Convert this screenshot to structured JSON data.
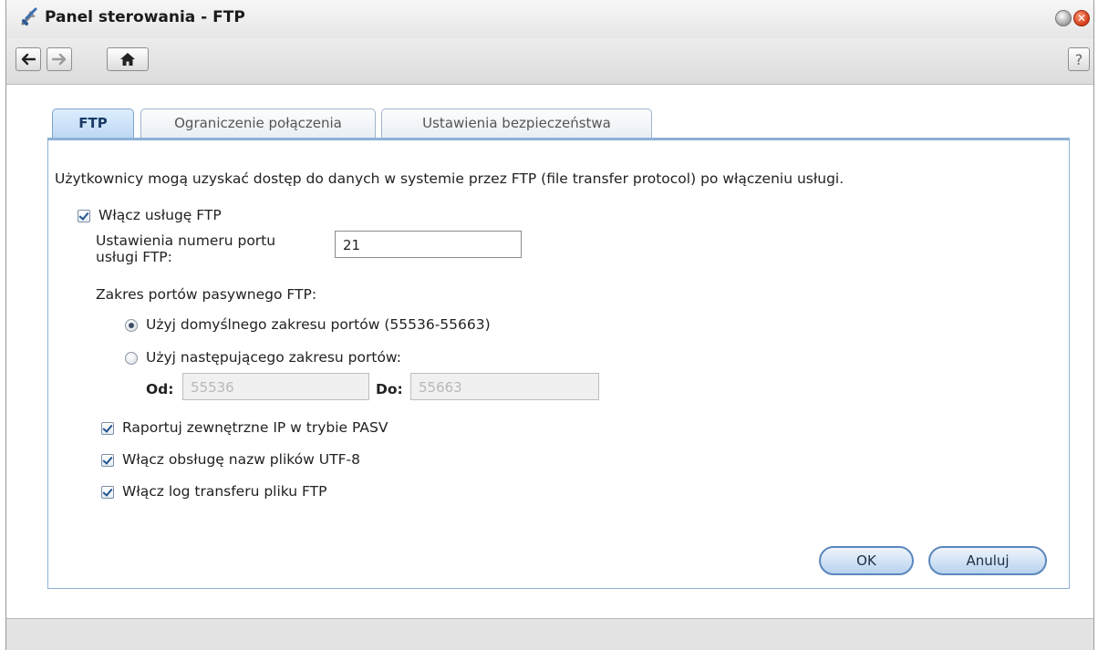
{
  "window": {
    "title": "Panel sterowania - FTP",
    "close_glyph": "✕"
  },
  "toolbar": {
    "back_icon": "arrow-left-icon",
    "forward_icon": "arrow-right-icon",
    "home_icon": "home-icon",
    "help_label": "?"
  },
  "tabs": [
    {
      "label": "FTP",
      "active": true
    },
    {
      "label": "Ograniczenie połączenia",
      "active": false
    },
    {
      "label": "Ustawienia bezpieczeństwa",
      "active": false
    }
  ],
  "description": "Użytkownicy mogą uzyskać dostęp do danych w systemie przez FTP (file transfer protocol) po włączeniu usługi.",
  "enable_ftp": {
    "label": "Włącz usługę FTP",
    "checked": true
  },
  "port": {
    "label_line1": "Ustawienia numeru portu",
    "label_line2": "usługi FTP:",
    "value": "21"
  },
  "passive": {
    "heading": "Zakres portów pasywnego FTP:",
    "option_default": "Użyj domyślnego zakresu portów (55536-55663)",
    "option_custom": "Użyj następującego zakresu portów:",
    "from_label": "Od:",
    "from_placeholder": "55536",
    "to_label": "Do:",
    "to_placeholder": "55663",
    "selected": "default"
  },
  "options": [
    {
      "label": "Raportuj zewnętrzne IP w trybie PASV",
      "checked": true
    },
    {
      "label": "Włącz obsługę nazw plików UTF-8",
      "checked": true
    },
    {
      "label": "Włącz log transferu pliku FTP",
      "checked": true
    }
  ],
  "buttons": {
    "ok": "OK",
    "cancel": "Anuluj"
  },
  "colors": {
    "accent": "#5a87bd",
    "panel_border": "#8cb0d6",
    "close": "#d33a17"
  }
}
